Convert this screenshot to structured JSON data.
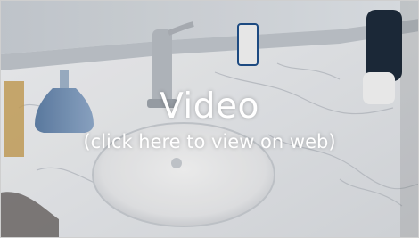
{
  "video_placeholder": {
    "title": "Video",
    "subtitle": "(click here to view on web)"
  },
  "colors": {
    "marble": "#e9ecef",
    "counter_edge": "#cfd3d8",
    "basin": "#f2f3f4",
    "mirror": "#d8dde2",
    "overlay_text": "#ffffff"
  },
  "icons": [
    "play-link-overlay"
  ]
}
